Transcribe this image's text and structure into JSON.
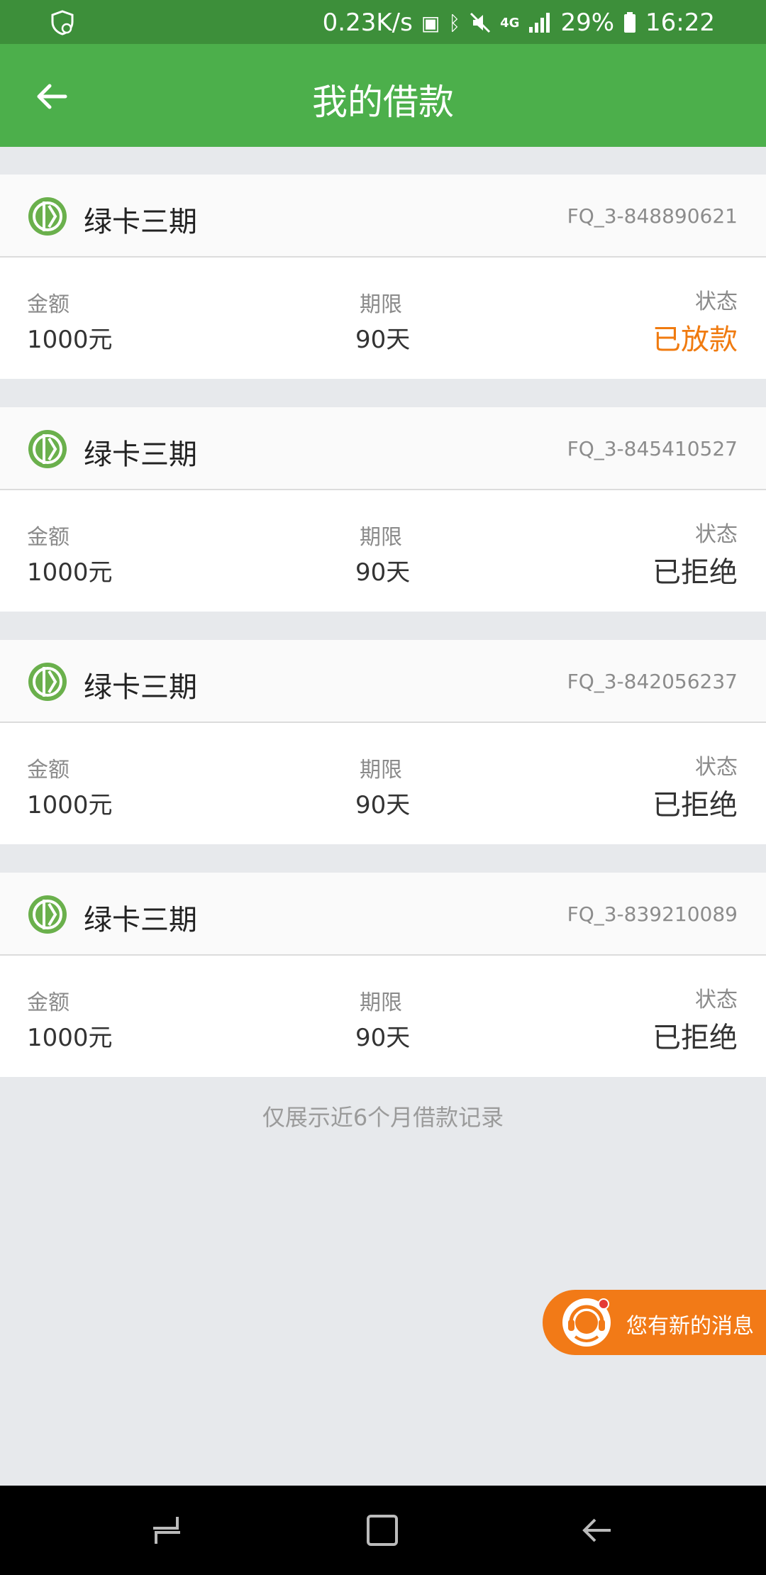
{
  "status_bar": {
    "speed": "0.23K/s",
    "network": "4G",
    "battery": "29%",
    "time": "16:22"
  },
  "app_bar": {
    "title": "我的借款",
    "back_icon": "arrow-left-icon"
  },
  "loans": [
    {
      "product": "绿卡三期",
      "id": "FQ_3-848890621",
      "amount_label": "金额",
      "amount": "1000元",
      "term_label": "期限",
      "term": "90天",
      "status_label": "状态",
      "status": "已放款",
      "status_color": "#f07b10"
    },
    {
      "product": "绿卡三期",
      "id": "FQ_3-845410527",
      "amount_label": "金额",
      "amount": "1000元",
      "term_label": "期限",
      "term": "90天",
      "status_label": "状态",
      "status": "已拒绝",
      "status_color": "#333333"
    },
    {
      "product": "绿卡三期",
      "id": "FQ_3-842056237",
      "amount_label": "金额",
      "amount": "1000元",
      "term_label": "期限",
      "term": "90天",
      "status_label": "状态",
      "status": "已拒绝",
      "status_color": "#333333"
    },
    {
      "product": "绿卡三期",
      "id": "FQ_3-839210089",
      "amount_label": "金额",
      "amount": "1000元",
      "term_label": "期限",
      "term": "90天",
      "status_label": "状态",
      "status": "已拒绝",
      "status_color": "#333333"
    }
  ],
  "footer_note": "仅展示近6个月借款记录",
  "message_button": {
    "label": "您有新的消息",
    "icon": "customer-service-icon"
  },
  "colors": {
    "status_bar": "#3d8f3a",
    "app_bar": "#4caf4b",
    "accent_orange": "#f27a17",
    "page_bg": "#e7e9ec"
  }
}
